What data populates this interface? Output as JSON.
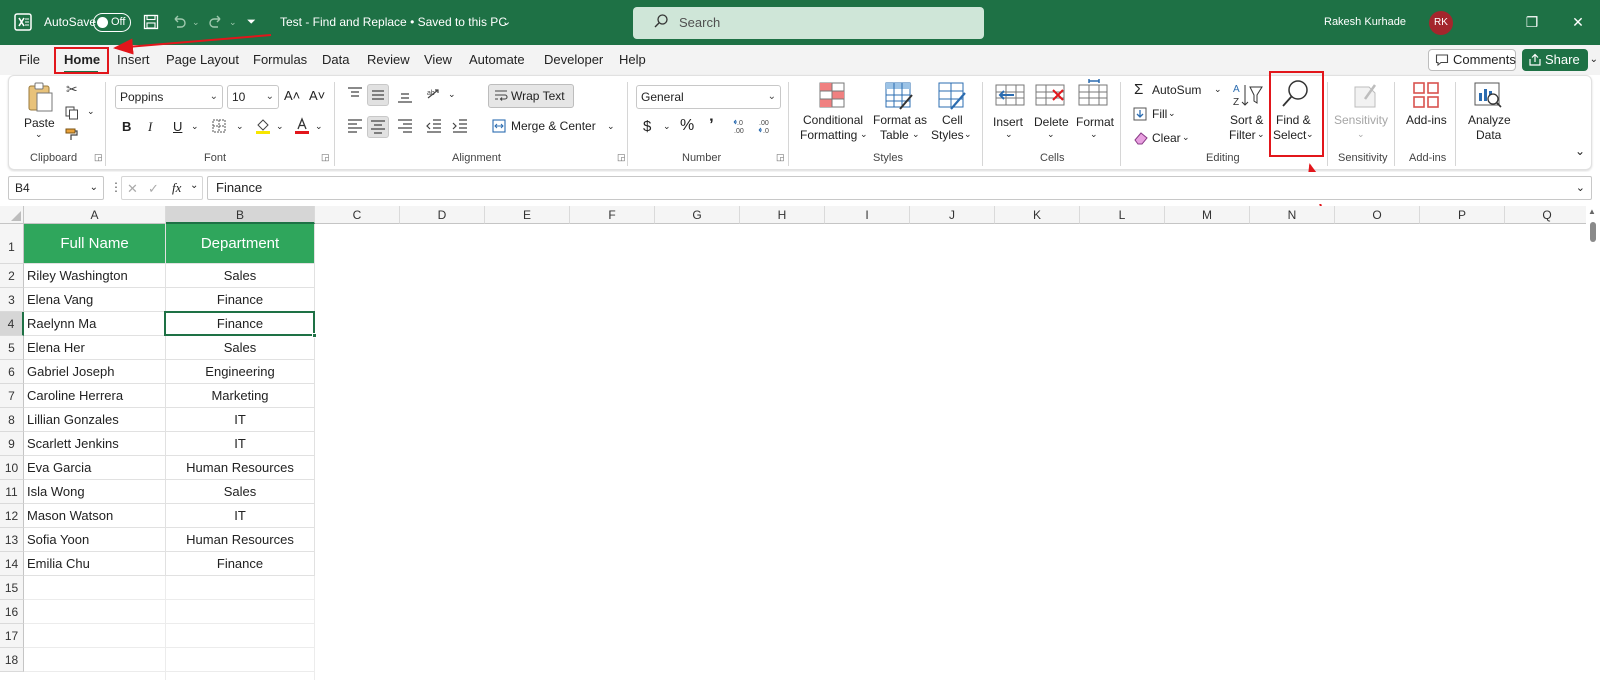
{
  "titlebar": {
    "autosave_label": "AutoSave",
    "autosave_state": "Off",
    "doc_title": "Test - Find and Replace • Saved to this PC",
    "search_placeholder": "Search",
    "user_name": "Rakesh Kurhade",
    "user_initials": "RK"
  },
  "menu": {
    "tabs": [
      "File",
      "Home",
      "Insert",
      "Page Layout",
      "Formulas",
      "Data",
      "Review",
      "View",
      "Automate",
      "Developer",
      "Help"
    ],
    "active_tab": "Home",
    "comments_label": "Comments",
    "share_label": "Share"
  },
  "ribbon": {
    "clipboard": {
      "paste": "Paste",
      "group": "Clipboard"
    },
    "font": {
      "name": "Poppins",
      "size": "10",
      "bold": "B",
      "italic": "I",
      "underline": "U",
      "group": "Font"
    },
    "alignment": {
      "wrap": "Wrap Text",
      "merge": "Merge & Center",
      "group": "Alignment"
    },
    "number": {
      "format": "General",
      "currency": "$",
      "percent": "%",
      "comma": "’",
      "group": "Number"
    },
    "styles": {
      "cond_1": "Conditional",
      "cond_2": "Formatting",
      "fmt_1": "Format as",
      "fmt_2": "Table",
      "cell_1": "Cell",
      "cell_2": "Styles",
      "group": "Styles"
    },
    "cells": {
      "insert": "Insert",
      "delete": "Delete",
      "format": "Format",
      "group": "Cells"
    },
    "editing": {
      "autosum": "AutoSum",
      "fill": "Fill",
      "clear": "Clear",
      "sort_1": "Sort &",
      "sort_2": "Filter",
      "find_1": "Find &",
      "find_2": "Select",
      "group": "Editing"
    },
    "sensitivity": {
      "label": "Sensitivity",
      "group": "Sensitivity"
    },
    "addins": {
      "label": "Add-ins",
      "group": "Add-ins"
    },
    "analyze": {
      "label_1": "Analyze",
      "label_2": "Data"
    }
  },
  "formula_bar": {
    "name_box": "B4",
    "fx": "fx",
    "value": "Finance"
  },
  "columns": [
    "A",
    "B",
    "C",
    "D",
    "E",
    "F",
    "G",
    "H",
    "I",
    "J",
    "K",
    "L",
    "M",
    "N",
    "O",
    "P",
    "Q"
  ],
  "sheet": {
    "headers": [
      "Full Name",
      "Department"
    ],
    "rows": [
      [
        "Riley Washington",
        "Sales"
      ],
      [
        "Elena Vang",
        "Finance"
      ],
      [
        "Raelynn Ma",
        "Finance"
      ],
      [
        "Elena Her",
        "Sales"
      ],
      [
        "Gabriel Joseph",
        "Engineering"
      ],
      [
        "Caroline Herrera",
        "Marketing"
      ],
      [
        "Lillian Gonzales",
        "IT"
      ],
      [
        "Scarlett Jenkins",
        "IT"
      ],
      [
        "Eva Garcia",
        "Human Resources"
      ],
      [
        "Isla Wong",
        "Sales"
      ],
      [
        "Mason Watson",
        "IT"
      ],
      [
        "Sofia Yoon",
        "Human Resources"
      ],
      [
        "Emilia Chu",
        "Finance"
      ]
    ],
    "row_numbers": [
      "1",
      "2",
      "3",
      "4",
      "5",
      "6",
      "7",
      "8",
      "9",
      "10",
      "11",
      "12",
      "13",
      "14",
      "15",
      "16",
      "17",
      "18"
    ],
    "active_cell": "B4"
  },
  "colors": {
    "excel_green": "#1e7145",
    "header_fill": "#2fa65c",
    "annotation_red": "#e2161b"
  }
}
